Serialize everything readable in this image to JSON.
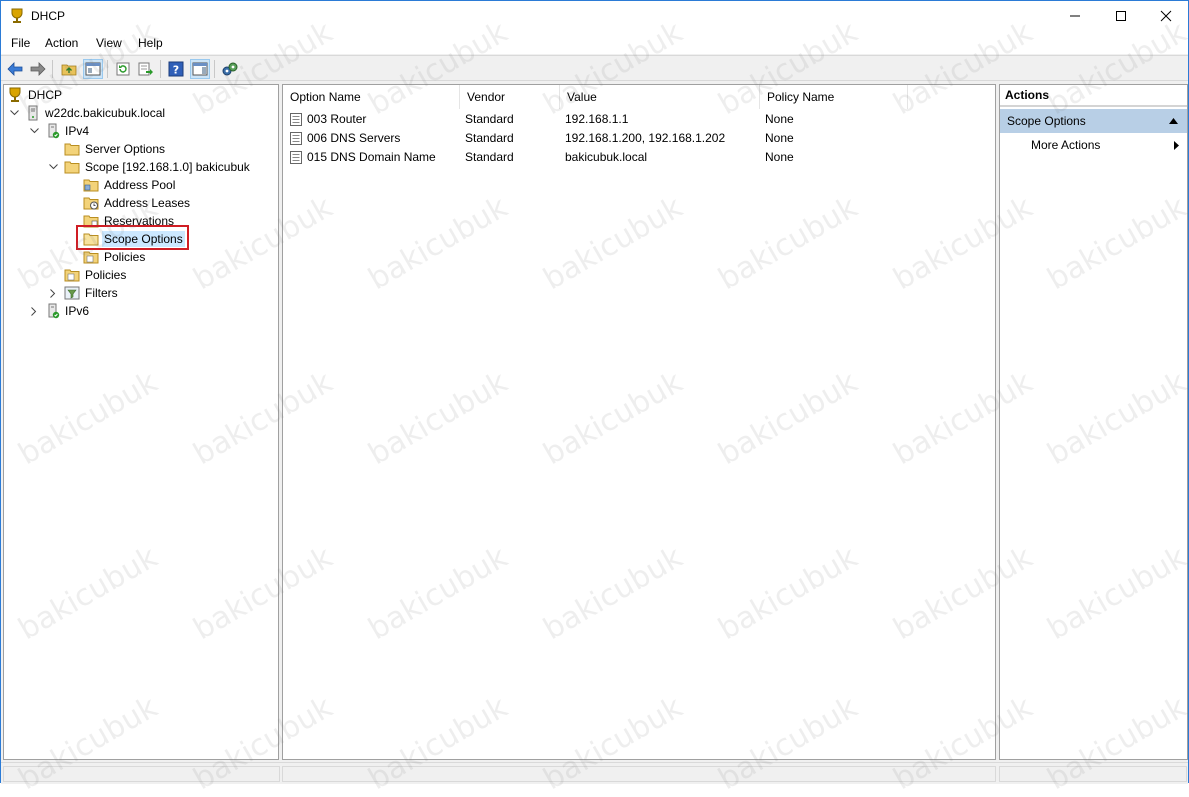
{
  "window": {
    "title": "DHCP",
    "controls": {
      "minimize": "minimize",
      "maximize": "maximize",
      "close": "close"
    }
  },
  "menu": {
    "items": [
      "File",
      "Action",
      "View",
      "Help"
    ]
  },
  "toolbar": {
    "buttons": [
      "back-icon",
      "forward-icon",
      "up-folder-icon",
      "show-hide-tree-icon",
      "refresh-icon",
      "export-list-icon",
      "help-icon",
      "show-hide-action-pane-icon",
      "dhcp-options-icon"
    ]
  },
  "tree": {
    "root": "DHCP",
    "server": "w22dc.bakicubuk.local",
    "ipv4": "IPv4",
    "server_options": "Server Options",
    "scope": "Scope [192.168.1.0] bakicubuk",
    "address_pool": "Address Pool",
    "address_leases": "Address Leases",
    "reservations": "Reservations",
    "scope_options": "Scope Options",
    "scope_policies": "Policies",
    "policies": "Policies",
    "filters": "Filters",
    "ipv6": "IPv6"
  },
  "list": {
    "columns": [
      "Option Name",
      "Vendor",
      "Value",
      "Policy Name"
    ],
    "rows": [
      {
        "name": "003 Router",
        "vendor": "Standard",
        "value": "192.168.1.1",
        "policy": "None"
      },
      {
        "name": "006 DNS Servers",
        "vendor": "Standard",
        "value": "192.168.1.200, 192.168.1.202",
        "policy": "None"
      },
      {
        "name": "015 DNS Domain Name",
        "vendor": "Standard",
        "value": "bakicubuk.local",
        "policy": "None"
      }
    ]
  },
  "actions": {
    "header": "Actions",
    "group": "Scope Options",
    "more": "More Actions"
  },
  "watermark": "bakicubuk",
  "colors": {
    "accent": "#2b7bd6",
    "selection": "#cce8ff",
    "highlight_box": "#d01d24",
    "actions_group": "#b8cfe6"
  }
}
